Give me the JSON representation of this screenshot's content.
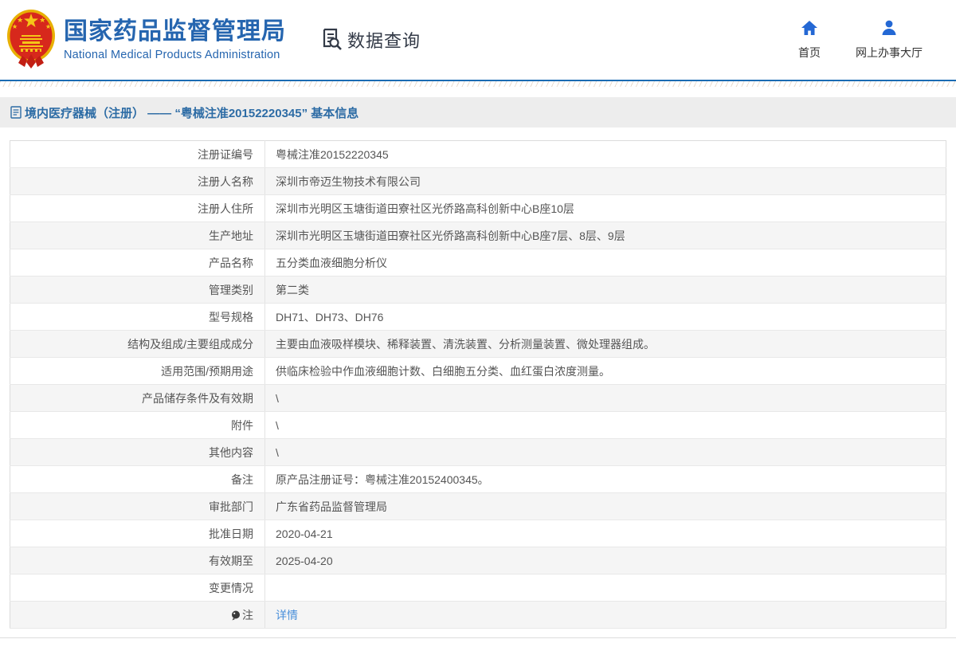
{
  "header": {
    "org_name_zh": "国家药品监督管理局",
    "org_name_en": "National Medical Products Administration",
    "query_label": "数据查询",
    "nav": [
      {
        "label": "首页",
        "icon": "home-icon"
      },
      {
        "label": "网上办事大厅",
        "icon": "user-icon"
      }
    ]
  },
  "page": {
    "title": "境内医疗器械（注册） —— “粤械注准20152220345” 基本信息"
  },
  "table": {
    "rows": [
      {
        "label": "注册证编号",
        "value": "粤械注准20152220345"
      },
      {
        "label": "注册人名称",
        "value": "深圳市帝迈生物技术有限公司"
      },
      {
        "label": "注册人住所",
        "value": "深圳市光明区玉塘街道田寮社区光侨路高科创新中心B座10层"
      },
      {
        "label": "生产地址",
        "value": "深圳市光明区玉塘街道田寮社区光侨路高科创新中心B座7层、8层、9层"
      },
      {
        "label": "产品名称",
        "value": "五分类血液细胞分析仪"
      },
      {
        "label": "管理类别",
        "value": "第二类"
      },
      {
        "label": "型号规格",
        "value": "DH71、DH73、DH76"
      },
      {
        "label": "结构及组成/主要组成成分",
        "value": "主要由血液吸样模块、稀释装置、清洗装置、分析测量装置、微处理器组成。"
      },
      {
        "label": "适用范围/预期用途",
        "value": "供临床检验中作血液细胞计数、白细胞五分类、血红蛋白浓度测量。"
      },
      {
        "label": "产品储存条件及有效期",
        "value": "\\"
      },
      {
        "label": "附件",
        "value": "\\"
      },
      {
        "label": "其他内容",
        "value": "\\"
      },
      {
        "label": "备注",
        "value": "原产品注册证号：粤械注准20152400345。"
      },
      {
        "label": "审批部门",
        "value": "广东省药品监督管理局"
      },
      {
        "label": "批准日期",
        "value": "2020-04-21"
      },
      {
        "label": "有效期至",
        "value": "2025-04-20"
      },
      {
        "label": "变更情况",
        "value": ""
      },
      {
        "label": "注",
        "value": "详情",
        "link": true,
        "icon": "bulb-icon"
      }
    ]
  },
  "colors": {
    "brand_blue": "#2565af",
    "nav_icon_blue": "#2468d4",
    "title_text_blue": "#2d6ca5",
    "link_blue": "#4a90da",
    "rule_blue": "#1b6cb3",
    "alt_row_bg": "#f5f5f5",
    "title_bar_bg": "#ededed",
    "emblem_red": "#d7281c",
    "emblem_gold": "#f0c419"
  }
}
